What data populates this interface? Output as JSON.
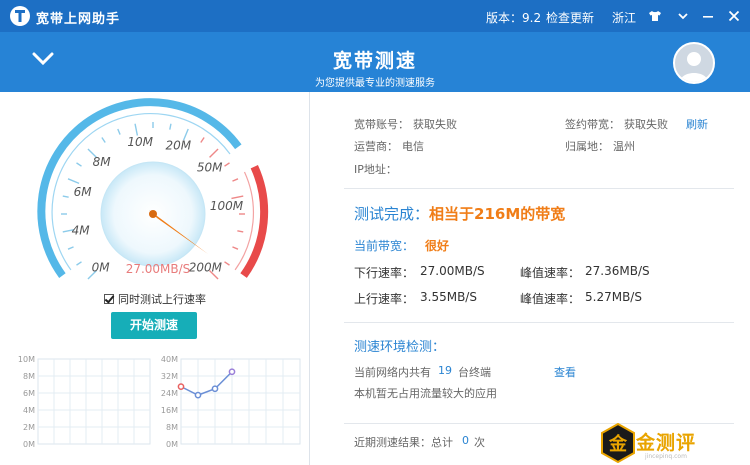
{
  "titlebar": {
    "app_title": "宽带上网助手",
    "version": "版本：9.2",
    "check_update": "检查更新",
    "region": "浙江",
    "icons": [
      "shirt-icon",
      "chevron-down-icon",
      "minimize-icon",
      "close-icon"
    ]
  },
  "header": {
    "title": "宽带测速",
    "subtitle": "为您提供最专业的测速服务"
  },
  "gauge": {
    "scale_labels": [
      "0M",
      "4M",
      "6M",
      "8M",
      "10M",
      "20M",
      "50M",
      "100M",
      "200M"
    ],
    "readout": "27.00MB/S",
    "needle_value_mbps": 216,
    "colors": {
      "blue": "#55b8e8",
      "red": "#e84a4a",
      "needle": "#f07d17"
    }
  },
  "options": {
    "upload_test_label": "同时测试上行速率",
    "upload_test_checked": true,
    "start_button": "开始测速"
  },
  "charts": {
    "left": {
      "y_ticks": [
        "10M",
        "8M",
        "6M",
        "4M",
        "2M",
        "0M"
      ]
    },
    "right": {
      "y_ticks": [
        "40M",
        "32M",
        "24M",
        "16M",
        "8M",
        "0M"
      ],
      "values_mb": [
        27,
        23,
        26,
        34
      ]
    }
  },
  "account": {
    "account_label": "宽带账号：",
    "account_value": "获取失败",
    "contract_label": "签约带宽：",
    "contract_value": "获取失败",
    "refresh": "刷新",
    "isp_label": "运营商：",
    "isp_value": "电信",
    "location_label": "归属地：",
    "location_value": "温州",
    "ip_label": "IP地址："
  },
  "result": {
    "status_prefix": "测试完成：",
    "status_value": "相当于216M的带宽",
    "current_label": "当前带宽：",
    "current_value": "很好",
    "down_label": "下行速率：",
    "down_value": "27.00MB/S",
    "down_peak_label": "峰值速率：",
    "down_peak_value": "27.36MB/S",
    "up_label": "上行速率：",
    "up_value": "3.55MB/S",
    "up_peak_label": "峰值速率：",
    "up_peak_value": "5.27MB/S"
  },
  "environment": {
    "title": "测速环境检测：",
    "devices_prefix": "当前网络内共有",
    "devices_count": "19",
    "devices_suffix": "台终端",
    "view_link": "查看",
    "traffic_note": "本机暂无占用流量较大的应用"
  },
  "history": {
    "prefix": "近期测速结果：总计",
    "count": "0",
    "suffix": "次"
  },
  "watermark": {
    "glyph": "金",
    "text": "金测评",
    "url": "jincepinq.com"
  }
}
